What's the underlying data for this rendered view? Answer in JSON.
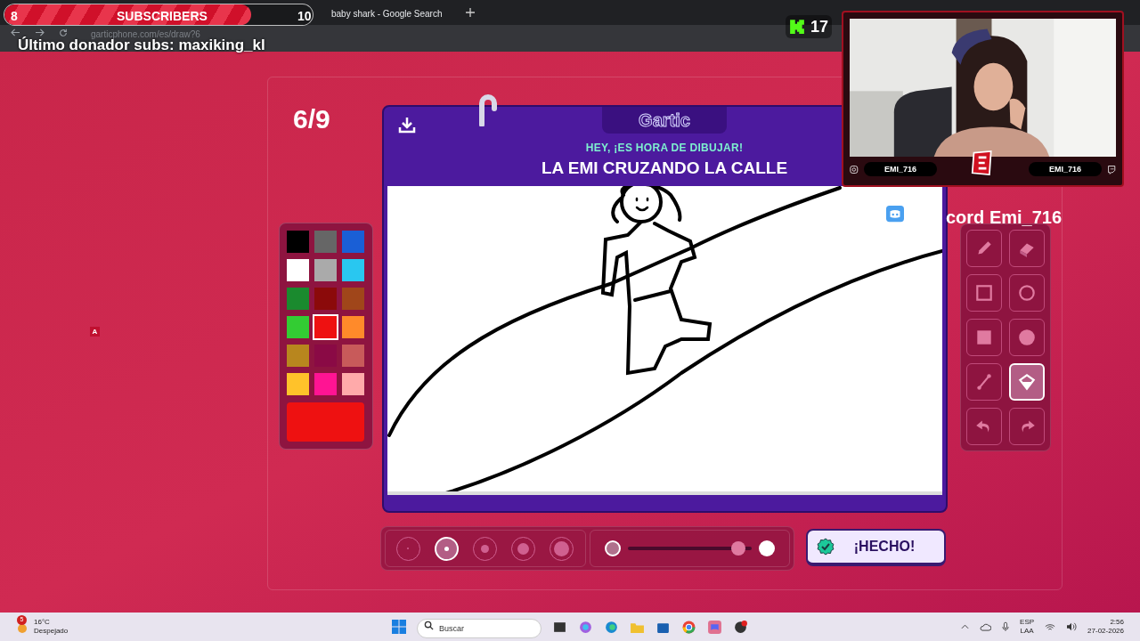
{
  "browser": {
    "tabs": [
      {
        "title": "baby shark - Google Search"
      }
    ],
    "url": "garticphone.com/es/draw?6"
  },
  "overlay": {
    "subs_goal": {
      "current": "8",
      "label": "SUBSCRIBERS",
      "target": "10",
      "level": 0.8
    },
    "last_donor": "Último donador subs: maxiking_kl",
    "viewers": "17",
    "webcam": {
      "left_name": "EMI_716",
      "right_name": "EMI_716"
    },
    "discord": "cord Emi_716",
    "marker": "A"
  },
  "game": {
    "round": "6/9",
    "logo": "Gartic",
    "hint": "HEY, ¡ES HORA DE DIBUJAR!",
    "prompt": "LA EMI CRUZANDO LA CALLE",
    "palette": [
      {
        "color": "#000000",
        "selected": false
      },
      {
        "color": "#666666",
        "selected": false
      },
      {
        "color": "#1a5fd6",
        "selected": false
      },
      {
        "color": "#ffffff",
        "selected": false
      },
      {
        "color": "#aaaaaa",
        "selected": false
      },
      {
        "color": "#29c7f0",
        "selected": false
      },
      {
        "color": "#1a8a2e",
        "selected": false
      },
      {
        "color": "#8b0a0a",
        "selected": false
      },
      {
        "color": "#a0461a",
        "selected": false
      },
      {
        "color": "#33cc33",
        "selected": false
      },
      {
        "color": "#ee1111",
        "selected": true
      },
      {
        "color": "#ff8a2a",
        "selected": false
      },
      {
        "color": "#b8861e",
        "selected": false
      },
      {
        "color": "#8a0a45",
        "selected": false
      },
      {
        "color": "#c85a5a",
        "selected": false
      },
      {
        "color": "#ffc22a",
        "selected": false
      },
      {
        "color": "#ff1493",
        "selected": false
      },
      {
        "color": "#ffaaaa",
        "selected": false
      }
    ],
    "tools": [
      {
        "kind": "pencil",
        "selected": false
      },
      {
        "kind": "eraser",
        "selected": false
      },
      {
        "kind": "rect",
        "selected": false
      },
      {
        "kind": "ellipse",
        "selected": false
      },
      {
        "kind": "rect_fill",
        "selected": false
      },
      {
        "kind": "ellipse_fill",
        "selected": false
      },
      {
        "kind": "line",
        "selected": false
      },
      {
        "kind": "bucket",
        "selected": true
      },
      {
        "kind": "undo",
        "selected": false
      },
      {
        "kind": "redo",
        "selected": false
      }
    ],
    "brush_sizes": [
      {
        "selected": false
      },
      {
        "selected": true
      },
      {
        "selected": false
      },
      {
        "selected": false
      },
      {
        "selected": false
      }
    ],
    "opacity": {
      "level": 0.95
    },
    "done_button": "¡HECHO!"
  },
  "taskbar": {
    "weather_badge": "5",
    "temperature": "16°C",
    "weather": "Despejado",
    "search_placeholder": "Buscar",
    "lang": "ESP",
    "layout": "LAA",
    "time": "2:56",
    "date": "27-02-2026"
  }
}
